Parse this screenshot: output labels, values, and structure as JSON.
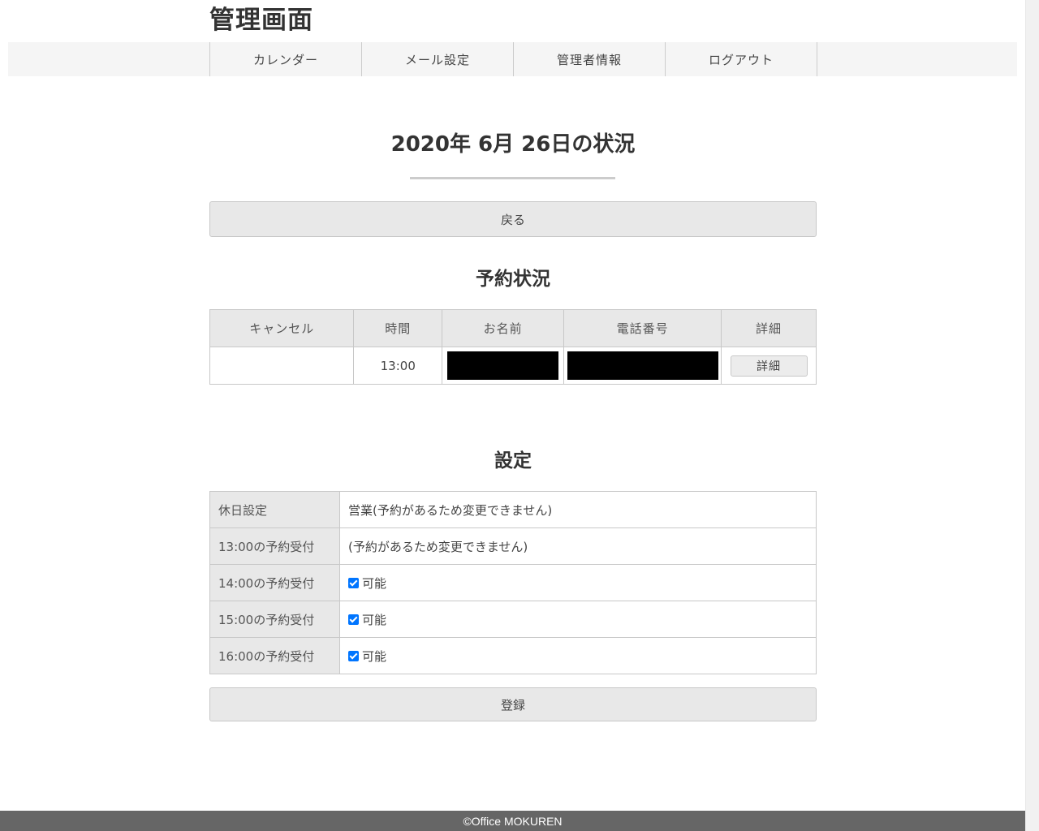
{
  "header": {
    "title": "管理画面"
  },
  "nav": {
    "items": [
      {
        "label": "カレンダー"
      },
      {
        "label": "メール設定"
      },
      {
        "label": "管理者情報"
      },
      {
        "label": "ログアウト"
      }
    ]
  },
  "main": {
    "heading": "2020年 6月 26日の状況",
    "back_label": "戻る",
    "reservations": {
      "heading": "予約状況",
      "columns": [
        "キャンセル",
        "時間",
        "お名前",
        "電話番号",
        "詳細"
      ],
      "rows": [
        {
          "cancel": "",
          "time": "13:00",
          "detail_label": "詳細"
        }
      ]
    },
    "settings": {
      "heading": "設定",
      "rows": [
        {
          "label": "休日設定",
          "value": "営業(予約があるため変更できません)"
        },
        {
          "label": "13:00の予約受付",
          "value": "(予約があるため変更できません)"
        },
        {
          "label": "14:00の予約受付",
          "value": "可能",
          "checked": true
        },
        {
          "label": "15:00の予約受付",
          "value": "可能",
          "checked": true
        },
        {
          "label": "16:00の予約受付",
          "value": "可能",
          "checked": true
        }
      ],
      "submit_label": "登録"
    }
  },
  "footer": {
    "text": "©Office MOKUREN"
  },
  "colors": {
    "footer_bg": "#666666",
    "checkbox": "#0075ff",
    "header_cell_bg": "#e8e8e8"
  }
}
